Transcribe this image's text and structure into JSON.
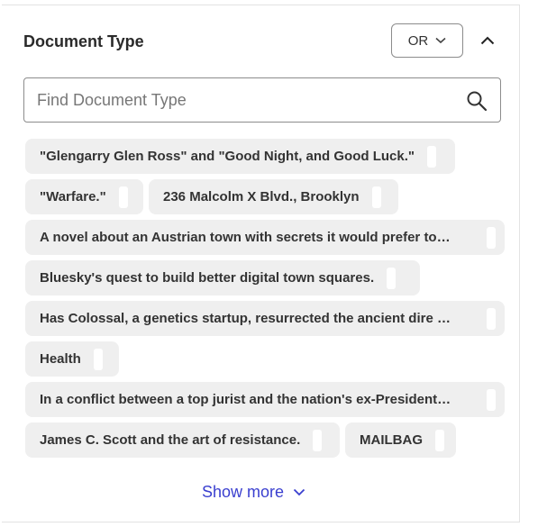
{
  "facet": {
    "title": "Document Type",
    "operator_label": "OR",
    "icons": {
      "operator": "chevron-down-icon",
      "collapse": "chevron-up-icon",
      "search": "search-icon",
      "show_more": "chevron-down-icon"
    },
    "colors": {
      "link": "#3a3fcf",
      "chip_bg": "#efefef",
      "border": "#8c8c8c"
    }
  },
  "search": {
    "placeholder": "Find Document Type",
    "value": ""
  },
  "chips": [
    {
      "label": "\"Glengarry Glen Ross\" and \"Good Night, and Good Luck.\""
    },
    {
      "label": "\"Warfare.\""
    },
    {
      "label": "236 Malcolm X Blvd., Brooklyn"
    },
    {
      "label": "A novel about an Austrian town with secrets it would prefer to…"
    },
    {
      "label": "Bluesky's quest to build better digital town squares."
    },
    {
      "label": "Has Colossal, a genetics startup, resurrected the ancient dire …"
    },
    {
      "label": "Health"
    },
    {
      "label": "In a conflict between a top jurist and the nation's ex-President…"
    },
    {
      "label": "James C. Scott and the art of resistance."
    },
    {
      "label": "MAILBAG"
    }
  ],
  "show_more_label": "Show more"
}
